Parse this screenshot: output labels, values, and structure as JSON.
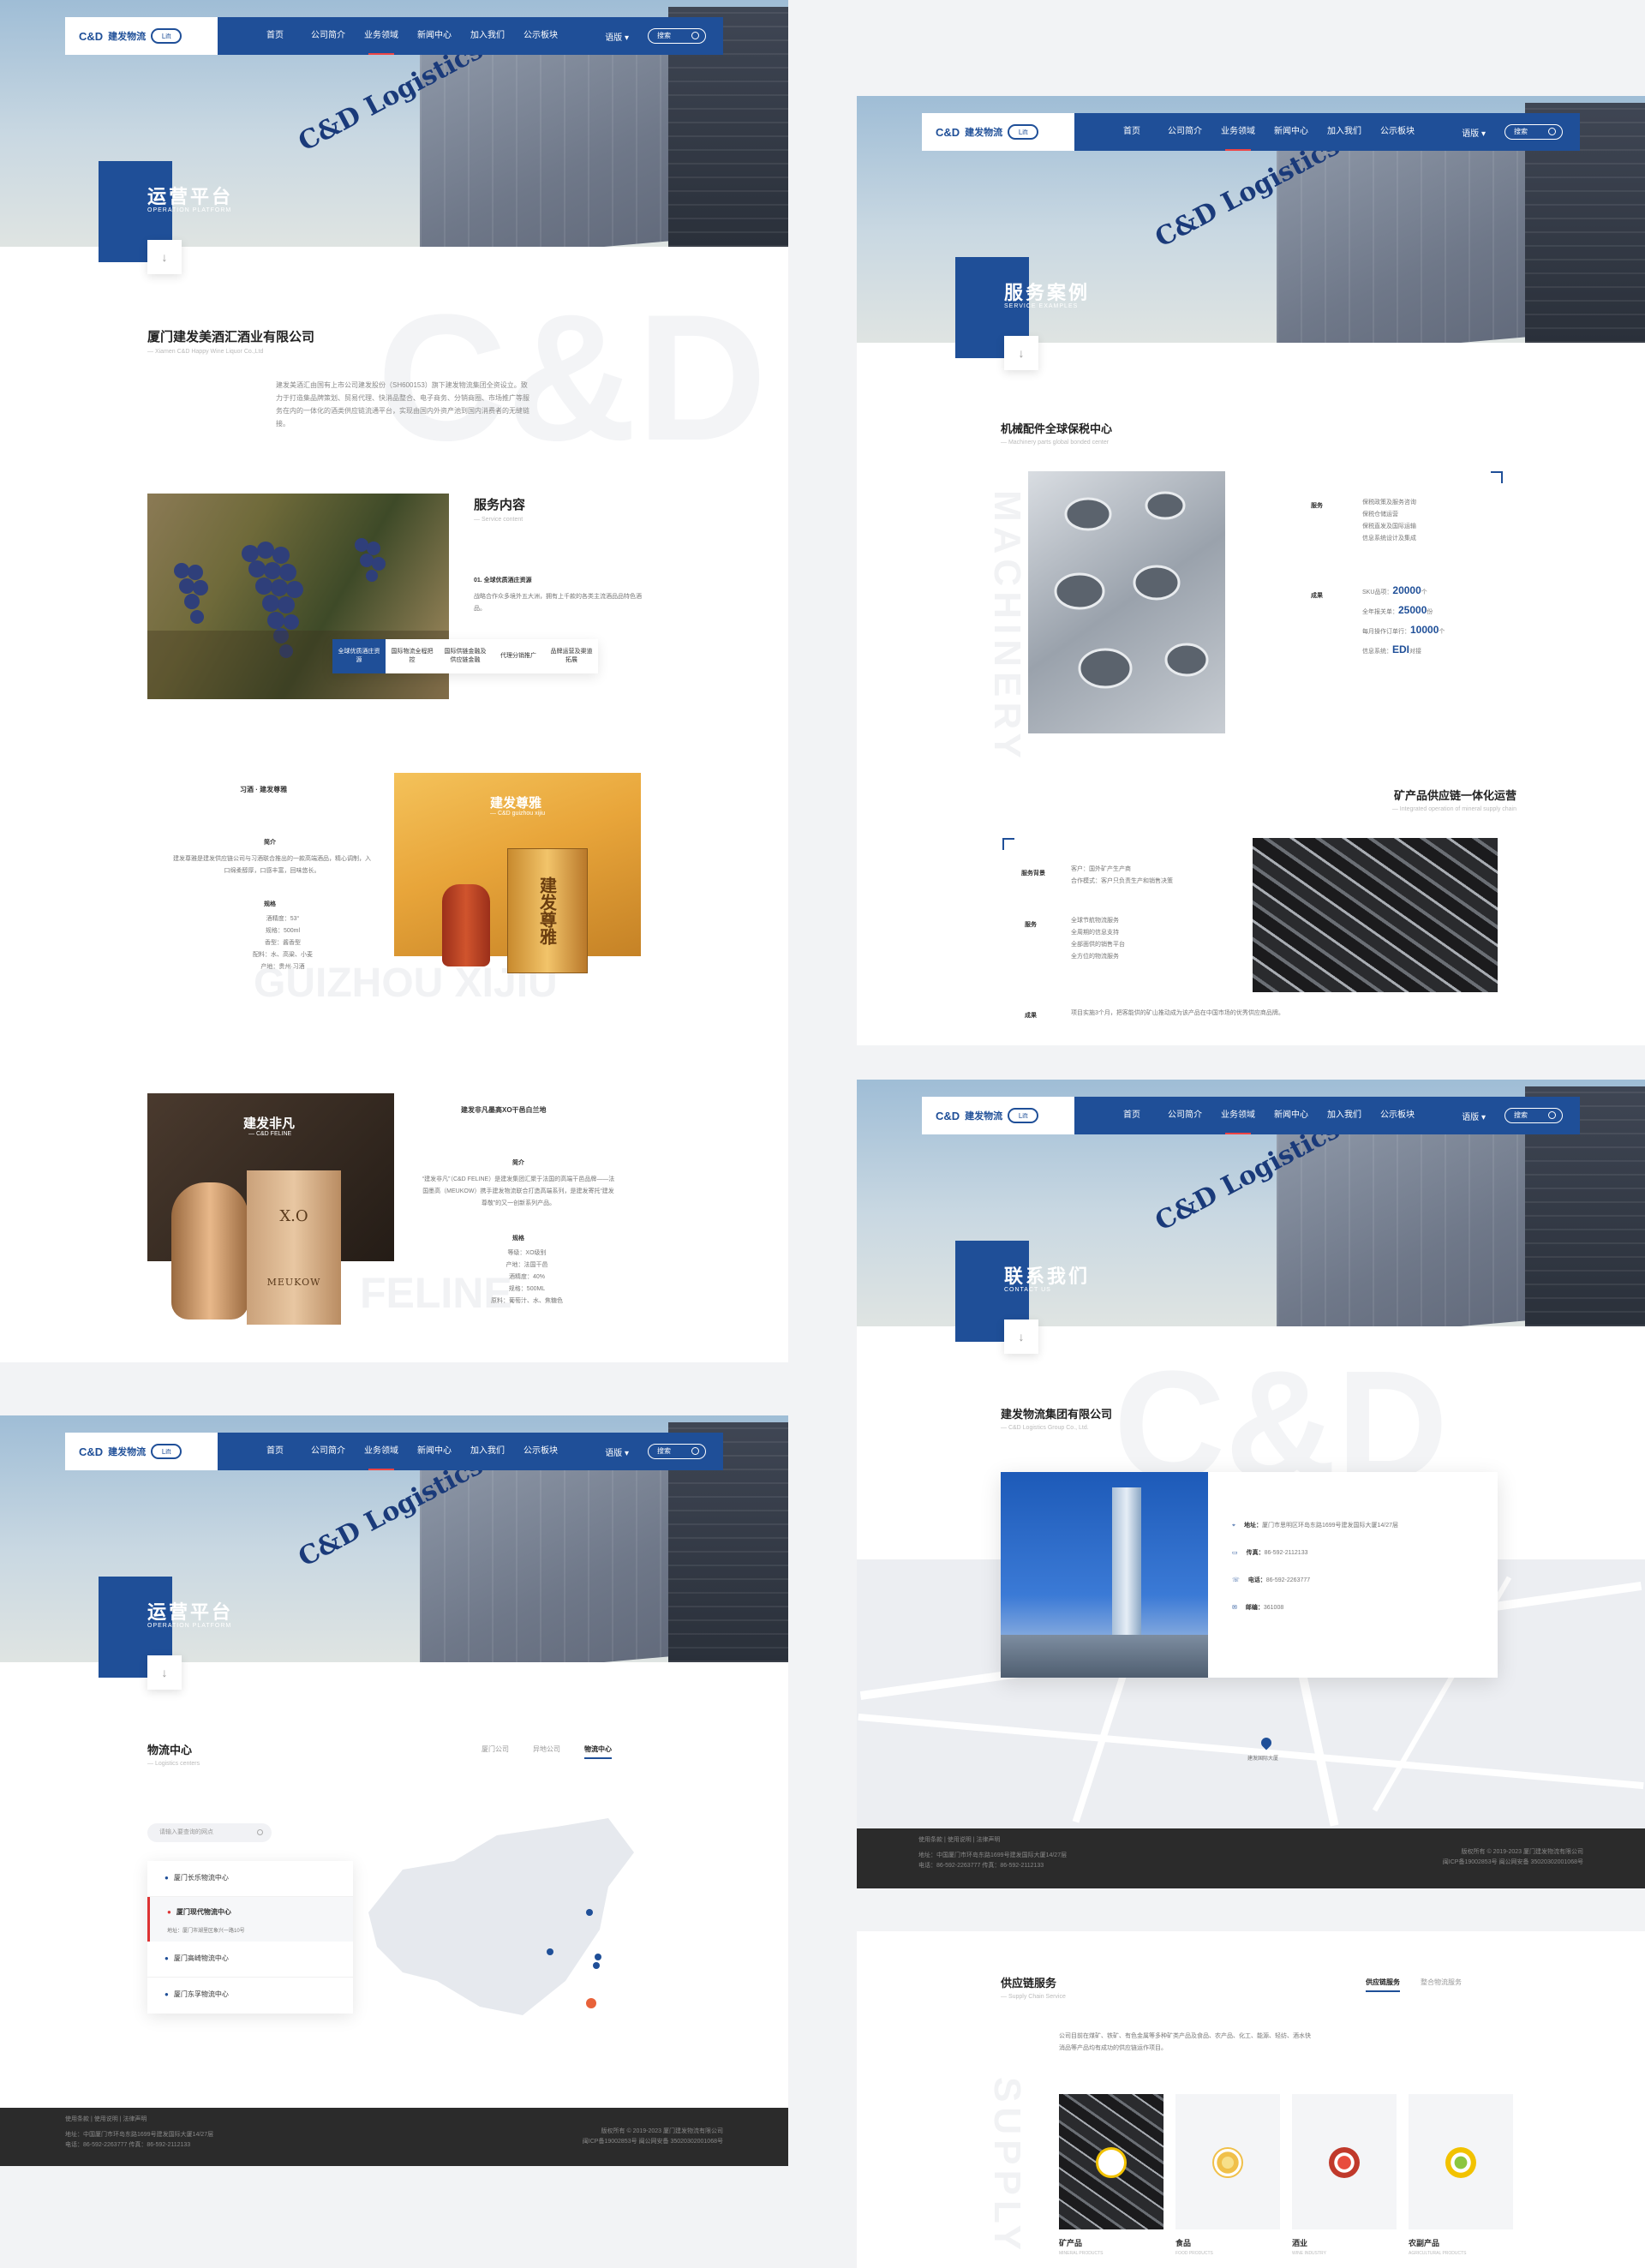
{
  "nav": {
    "logo_cd": "C&D",
    "logo_zh": "建发物流",
    "logo_lift": "Lift",
    "links": [
      "首页",
      "公司简介",
      "业务领域",
      "新闻中心",
      "加入我们",
      "公示板块"
    ],
    "lang": "语版 ▾",
    "search_placeholder": "搜索"
  },
  "hero": {
    "sign": "C&D Logistics"
  },
  "panel1": {
    "title": "运营平台",
    "subtitle": "OPERATION PLATFORM",
    "company": "厦门建发美酒汇酒业有限公司",
    "company_en": "— Xiamen C&D Happy Wine Liquor Co.,Ltd",
    "intro": "建发美酒汇由国有上市公司建发股份（SH600153）旗下建发物流集团全资设立。致力于打造集品牌策划、贸易代理、快消品整合、电子商务、分销商圈、市场推广等服务在内的一体化的酒类供应链流通平台，实现由国内外资产池到国内消费者的无缝链接。",
    "service_title": "服务内容",
    "service_sub": "— Service content",
    "service_item": "01. 全球优质酒庄资源",
    "service_desc": "战略合作众多境外五大洲，拥有上千款的各类主流酒品品特色酒品。",
    "tabs": [
      "全球优质酒庄资源",
      "国际物流全程把控",
      "国际供链金融及供应链金融",
      "代理分销推广",
      "品牌运营及渠道拓展"
    ],
    "wine1_label": "习酒 · 建发尊雅",
    "wine1_intro_h": "简介",
    "wine1_intro": "建发尊雅是建发供应链公司与习酒联合推出的一款高端酒品，精心调制，入口绵柔醇厚，口感丰富，回味悠长。",
    "wine1_spec_h": "规格",
    "wine1_specs": [
      "酒精度：53°",
      "规格：500ml",
      "香型：酱香型",
      "配料：水、高粱、小麦",
      "产地：贵州·习酒"
    ],
    "wine1_banner": "建发尊雅",
    "wine1_banner_sub": "— C&D guizhou xijiu",
    "wine1_bottle_label": "建发尊雅",
    "wine1_wm": "GUIZHOU XIJIU",
    "wine2_banner": "建发非凡",
    "wine2_banner_sub": "— C&D FELINE",
    "wine2_title": "建发非凡墨高XO干邑白兰地",
    "wine2_intro_h": "简介",
    "wine2_intro": "“建发非凡”（C&D FELINE）是建发集团汇聚于法国的高端干邑品牌——法国墨高（MEUKOW）携手建发物流联合打造高端系列，是建发寄托“建发尊敬”的又一创新系列产品。",
    "wine2_spec_h": "规格",
    "wine2_specs": [
      "等级：XO级别",
      "产地：法国干邑",
      "酒精度：40%",
      "规格：500ML",
      "原料：葡萄汁、水、焦糖色"
    ],
    "wine2_box_text": "X.O",
    "wine2_bottle_text": "MEUKOW",
    "wine2_wm": "FELINE"
  },
  "panel2": {
    "title": "服务案例",
    "subtitle": "SERVICE EXAMPLES",
    "case1_title": "机械配件全球保税中心",
    "case1_sub": "— Machinery parts global bonded center",
    "label_service": "服务",
    "label_result": "成果",
    "services": [
      "保税政策及服务咨询",
      "保税仓储运营",
      "保税直发及国际运输",
      "信息系统设计及集成"
    ],
    "results": [
      {
        "pre": "SKU品项：",
        "num": "20000",
        "unit": "个"
      },
      {
        "pre": "全年报关单：",
        "num": "25000",
        "unit": "份"
      },
      {
        "pre": "每月操作订单行：",
        "num": "10000",
        "unit": "个"
      },
      {
        "pre": "信息系统：",
        "num": "EDI",
        "unit": "对接"
      }
    ],
    "wm": "MACHINERY",
    "case2_title": "矿产品供应链一体化运营",
    "case2_sub": "— Integrated operation of mineral supply chain",
    "label_bg": "服务背景",
    "bg_items": [
      "客户：国外矿产生产商",
      "合作模式：客户只负责生产和销售决策"
    ],
    "services2": [
      "全球节航物流服务",
      "全周期的信息支持",
      "全部面供的销售平台",
      "全方位的物流服务"
    ],
    "result2": "项目实施3个月，把客能供的矿山推动成为该产品在中国市场的优秀供应商品牌。"
  },
  "panel3": {
    "title": "联系我们",
    "subtitle": "CONTACT US",
    "company": "建发物流集团有限公司",
    "company_en": "— C&D Logistics Group Co., Ltd.",
    "address_label": "地址：",
    "address": "厦门市思明区环岛东路1699号建发国际大厦14/27层",
    "fax_label": "传真：",
    "fax": "86-592-2112133",
    "phone_label": "电话：",
    "phone": "86-592-2263777",
    "zip_label": "邮编：",
    "zip": "361008",
    "map_pin": "建发国际大厦",
    "footer_links": [
      "使用条款",
      "使用说明",
      "法律声明"
    ],
    "footer_addr": "地址：中国厦门市环岛东路1699号建发国际大厦14/27层",
    "footer_tel": "电话：86-592-2263777  传真：86-592-2112133",
    "footer_copy": "版权所有 © 2019-2023 厦门建发物流有限公司",
    "footer_icp": "闽ICP备19002853号    闽公网安备 35020302001068号"
  },
  "panel4": {
    "title": "运营平台",
    "subtitle": "OPERATION PLATFORM",
    "section": "物流中心",
    "section_sub": "— Logistics centers",
    "tabs": [
      "厦门公司",
      "异地公司",
      "物流中心"
    ],
    "search_placeholder": "请输入要查询的网点",
    "centers": [
      "厦门长乐物流中心",
      "厦门现代物流中心",
      "厦门高崎物流中心",
      "厦门东孚物流中心"
    ],
    "center_addr": "地址：厦门市湖里区象兴一路10号",
    "footer_links": [
      "使用条款",
      "使用说明",
      "法律声明"
    ],
    "footer_addr": "地址：中国厦门市环岛东路1699号建发国际大厦14/27层",
    "footer_tel": "电话：86-592-2263777  传真：86-592-2112133",
    "footer_copy": "版权所有 © 2019-2023 厦门建发物流有限公司",
    "footer_icp": "闽ICP备19002853号    闽公网安备 35020302001068号"
  },
  "panel5": {
    "section": "供应链服务",
    "section_sub": "— Supply Chain Service",
    "tabs": [
      "供应链服务",
      "整合物流服务"
    ],
    "desc": "公司目前在煤矿、铁矿、有色金属等多种矿类产品及食品、农产品、化工、能源、轻纺、酒水快消品等产品均有成功的供应链运作项目。",
    "cards": [
      {
        "zh": "矿产品",
        "en": "MINERAL PRODUCTS"
      },
      {
        "zh": "食品",
        "en": "FOOD PRODUCTS"
      },
      {
        "zh": "酒业",
        "en": "WINE INDUSTRY"
      },
      {
        "zh": "农副产品",
        "en": "AGRICULTURAL PRODUCTS"
      }
    ],
    "wm": "SUPPLY"
  }
}
